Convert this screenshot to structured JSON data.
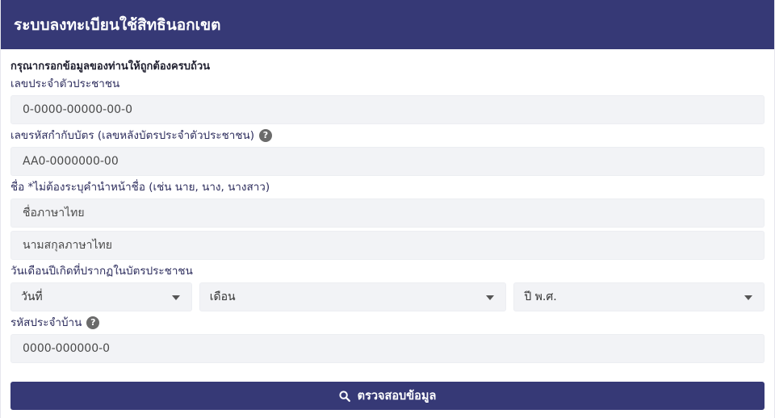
{
  "header": {
    "title": "ระบบลงทะเบียนใช้สิทธินอกเขต"
  },
  "form": {
    "intro": "กรุณากรอกข้อมูลของท่านให้ถูกต้องครบถ้วน",
    "citizen_id": {
      "label": "เลขประจำตัวประชาชน",
      "placeholder": "0-0000-00000-00-0"
    },
    "laser_code": {
      "label": "เลขรหัสกำกับบัตร (เลขหลังบัตรประจำตัวประชาชน)",
      "help_icon": "question-circle-icon",
      "placeholder": "AA0-0000000-00"
    },
    "name": {
      "label": "ชื่อ *ไม่ต้องระบุคำนำหน้าชื่อ (เช่น นาย, นาง, นางสาว)",
      "first_placeholder": "ชื่อภาษาไทย",
      "last_placeholder": "นามสกุลภาษาไทย"
    },
    "birthdate": {
      "label": "วันเดือนปีเกิดที่ปรากฏในบัตรประชาชน",
      "day": "วันที่",
      "month": "เดือน",
      "year": "ปี พ.ศ."
    },
    "house_code": {
      "label": "รหัสประจำบ้าน",
      "help_icon": "question-circle-icon",
      "placeholder": "0000-000000-0"
    },
    "submit": {
      "label": "ตรวจสอบข้อมูล",
      "icon": "search-icon"
    }
  },
  "colors": {
    "primary": "#363976",
    "field_bg": "#f2f3f6"
  }
}
